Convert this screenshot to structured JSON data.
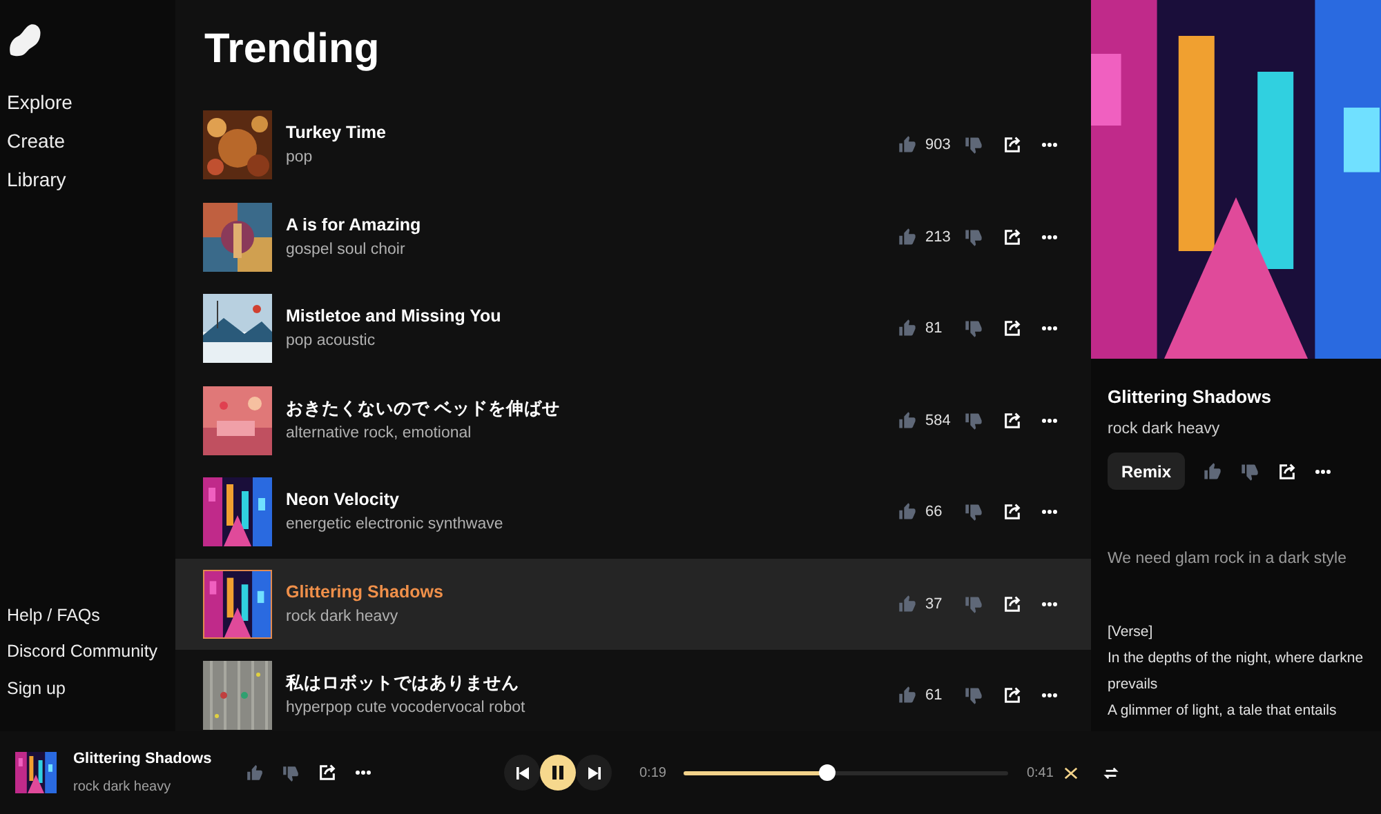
{
  "sidebar": {
    "nav": [
      "Explore",
      "Create",
      "Library"
    ],
    "footer": [
      "Help / FAQs",
      "Discord Community",
      "Sign up"
    ]
  },
  "main": {
    "title": "Trending",
    "songs": [
      {
        "title": "Turkey Time",
        "tags": "pop",
        "likes": "903",
        "selected": false
      },
      {
        "title": "A is for Amazing",
        "tags": "gospel soul choir",
        "likes": "213",
        "selected": false
      },
      {
        "title": "Mistletoe and Missing You",
        "tags": "pop acoustic",
        "likes": "81",
        "selected": false
      },
      {
        "title": "おきたくないので ベッドを伸ばせ",
        "tags": "alternative rock, emotional",
        "likes": "584",
        "selected": false
      },
      {
        "title": "Neon Velocity",
        "tags": "energetic electronic synthwave",
        "likes": "66",
        "selected": false
      },
      {
        "title": "Glittering Shadows",
        "tags": "rock dark heavy",
        "likes": "37",
        "selected": true
      },
      {
        "title": "私はロボットではありません",
        "tags": "hyperpop cute vocodervocal robot",
        "likes": "61",
        "selected": false
      }
    ]
  },
  "detail": {
    "title": "Glittering Shadows",
    "tags": "rock dark heavy",
    "remix": "Remix",
    "prompt": "We need glam rock in a dark style",
    "lyrics": [
      "[Verse]",
      "In the depths of the night, where darkne",
      "prevails",
      "A glimmer of light, a tale that entails"
    ]
  },
  "player": {
    "title": "Glittering Shadows",
    "tags": "rock dark heavy",
    "playing": true,
    "elapsed": "0:19",
    "duration": "0:41",
    "level": 0.44
  }
}
